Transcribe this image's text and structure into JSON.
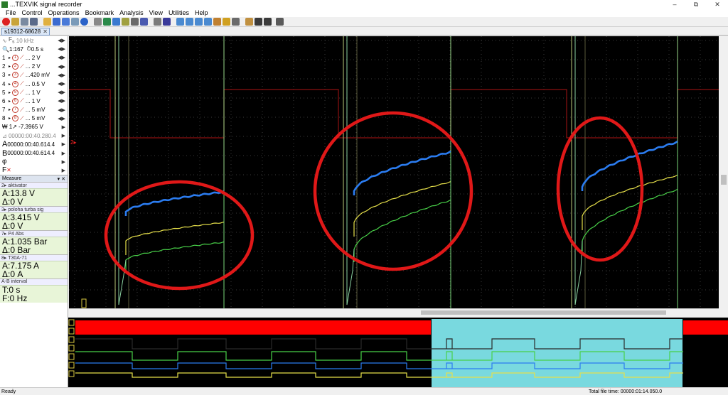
{
  "window": {
    "title": "...TEXVIK  signal recorder",
    "min": "–",
    "max": "⧉",
    "close": "✕"
  },
  "menu": [
    "File",
    "Control",
    "Operations",
    "Bookmark",
    "Analysis",
    "View",
    "Utilities",
    "Help"
  ],
  "tab": {
    "label": "s19312-68628",
    "close": "✕"
  },
  "left_panel": {
    "freq": "10 kHz",
    "zoom": "1:167",
    "timebase": "0.5 s",
    "channels": [
      {
        "num": "1",
        "icon": "1",
        "value": "... 2 V"
      },
      {
        "num": "2",
        "icon": "2",
        "value": "... 2 V"
      },
      {
        "num": "3",
        "icon": "3",
        "value": "...420 mV"
      },
      {
        "num": "4",
        "icon": "4",
        "value": "... 0.5 V"
      },
      {
        "num": "5",
        "icon": "5",
        "value": "... 1 V"
      },
      {
        "num": "6",
        "icon": "6",
        "value": "... 1 V"
      },
      {
        "num": "7",
        "icon": "7",
        "value": "... 5 mV"
      },
      {
        "num": "8",
        "icon": "8",
        "value": "... 5 mV"
      }
    ],
    "trigger": "1↗ -7.3965 V",
    "cursor_time": "00000:00:40.280.4",
    "cursor_a": "00000:00:40.614.4",
    "cursor_b": "00000:00:40.614.4",
    "phi": "φ",
    "f_label": "F",
    "measure_title": "Measure",
    "measures": [
      {
        "label": "2▸ aktivator",
        "a": "A:13.8 V",
        "d": "Δ:0 V"
      },
      {
        "label": "3▸ poloha turba sig",
        "a": "A:3.415 V",
        "d": "Δ:0 V"
      },
      {
        "label": "7▸ P4 Abs",
        "a": "A:1.035 Bar",
        "d": "Δ:0 Bar"
      },
      {
        "label": "8▸ T30A-71",
        "a": "A:7.175 A",
        "d": "Δ:0 A"
      },
      {
        "label": "A-B interval",
        "a": "T:0 s",
        "d": "F:0 Hz"
      }
    ]
  },
  "scope": {
    "trigger_marker": "2▸"
  },
  "status": {
    "ready": "Ready",
    "total": "Total file time: 00000:01:14.050.0"
  },
  "colors": {
    "red_trace": "#8b1010",
    "blue_trace": "#2b7cf0",
    "yellow_trace": "#e6e04a",
    "green_trace": "#48d048",
    "white_trace": "#d8d8d8",
    "circle": "#e01818",
    "overview_band": "#ff0000",
    "selection": "#79d9df"
  }
}
